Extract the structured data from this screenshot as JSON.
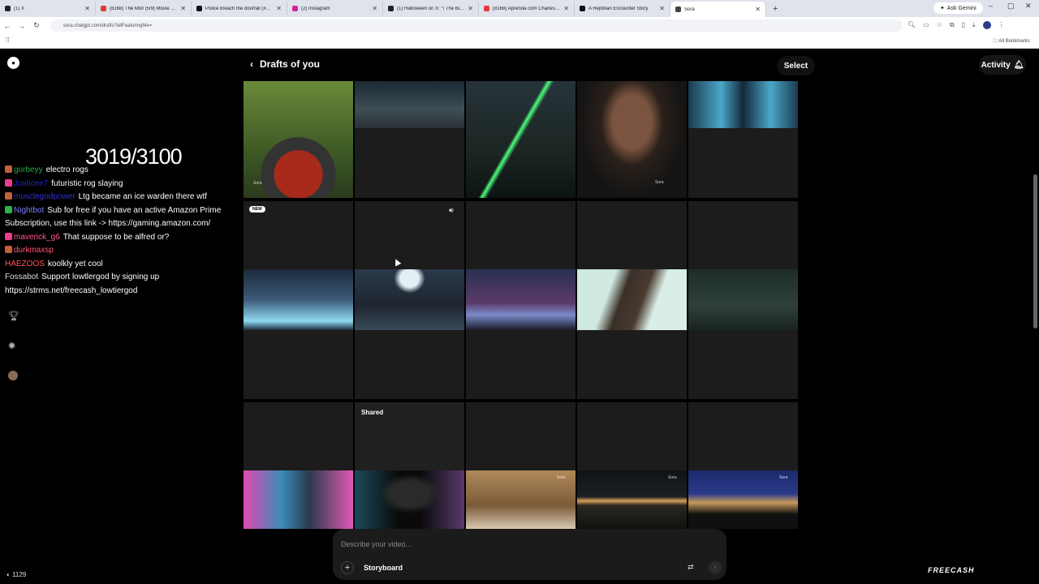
{
  "browser": {
    "tabs": [
      {
        "title": "(1) X",
        "color": "#222222"
      },
      {
        "title": "(8168) The Mist (5/9) Movie Cl...",
        "color": "#e53935"
      },
      {
        "title": "Police breach the doorfall (#Fy...",
        "color": "#111111"
      },
      {
        "title": "(2) Instagram",
        "color": "#d6249f"
      },
      {
        "title": "(1) Halloween on X: \"\\ The Bi...",
        "color": "#222222"
      },
      {
        "title": "(8168) Aprenda com Charles d...",
        "color": "#e53935"
      },
      {
        "title": "A Reptilian Encounter Story",
        "color": "#111111"
      },
      {
        "title": "Sora",
        "color": "#444444"
      }
    ],
    "ask_gemini": "Ask Gemini",
    "url": "sora.chatgpt.com/drafts?allFeaturingMe=",
    "all_bookmarks": "All Bookmarks"
  },
  "header": {
    "title": "Drafts of you",
    "select": "Select",
    "activity": "Activity"
  },
  "labels": {
    "new_badge": "NEW",
    "shared": "Shared",
    "watermark": "Sora"
  },
  "stream": {
    "counter": "3019/3100",
    "chat": [
      {
        "user": "gorbeyy",
        "user_color": "#22a84a",
        "msg": "electro rogs",
        "badge_color": "#c2603a"
      },
      {
        "user": "Justicee7",
        "user_color": "#2222cc",
        "msg": "futuristic rog slaying",
        "badge_color": "#e83e8c"
      },
      {
        "user": "musclegodpower",
        "user_color": "#3030cc",
        "msg": "Ltg became an ice warden there wtf",
        "badge_color": "#c2603a"
      },
      {
        "user": "Nightbot",
        "user_color": "#7c7cff",
        "msg": "Sub for free if you have an active Amazon Prime Subscription, use this link -> https://gaming.amazon.com/",
        "badge_color": "#2fb34a"
      },
      {
        "user": "maverick_g6",
        "user_color": "#ff5a8a",
        "msg": "That suppose to be alfred or?",
        "badge_color": "#e83e8c"
      },
      {
        "user": "durkmaxsp",
        "user_color": "#ff5577",
        "msg": "",
        "badge_color": "#c2603a"
      },
      {
        "user": "HAEZOOS",
        "user_color": "#ff5555",
        "msg": "koolkly yet cool",
        "badge_color": ""
      },
      {
        "user": "Fossabot",
        "user_color": "#dddddd",
        "msg": "Support lowtlergod by signing up https://strms.net/freecash_lowtiergod",
        "badge_color": ""
      }
    ],
    "bottom_count": "1129",
    "freecash": "FREECASH"
  },
  "composer": {
    "placeholder": "Describe your video...",
    "storyboard": "Storyboard"
  }
}
